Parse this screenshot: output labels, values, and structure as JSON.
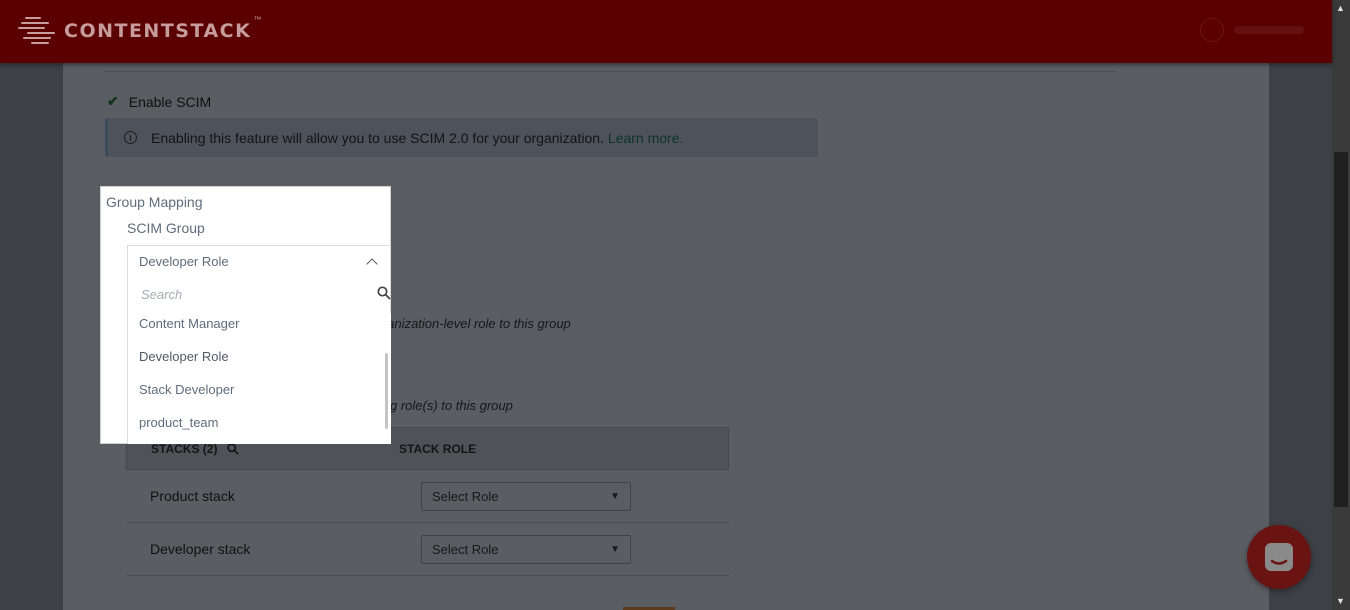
{
  "brand": {
    "logo_text": "CONTENTSTACK",
    "trademark": "™"
  },
  "colors": {
    "header": "#5a0000",
    "overlay_bg": "#5a5d62",
    "link": "#0d3326",
    "chat": "#6a1313"
  },
  "scim": {
    "enable_label": "Enable SCIM",
    "info_text": "Enabling this feature will allow you to use SCIM 2.0 for your organization.",
    "learn_more": "Learn more."
  },
  "hints": {
    "org_role": "ganization-level role to this group",
    "stack_role": "g role(s) to this group"
  },
  "group_mapping": {
    "title": "Group Mapping",
    "scim_group_label": "SCIM Group",
    "selected_value": "Developer Role",
    "search_placeholder": "Search",
    "options": [
      {
        "label": "Content Manager"
      },
      {
        "label": "Developer Role"
      },
      {
        "label": "Stack Developer"
      },
      {
        "label": "product_team"
      }
    ]
  },
  "stacks_table": {
    "col_stacks": "STACKS (2)",
    "col_role": "STACK ROLE",
    "rows": [
      {
        "name": "Product stack",
        "role": "Select Role"
      },
      {
        "name": "Developer stack",
        "role": "Select Role"
      }
    ]
  }
}
